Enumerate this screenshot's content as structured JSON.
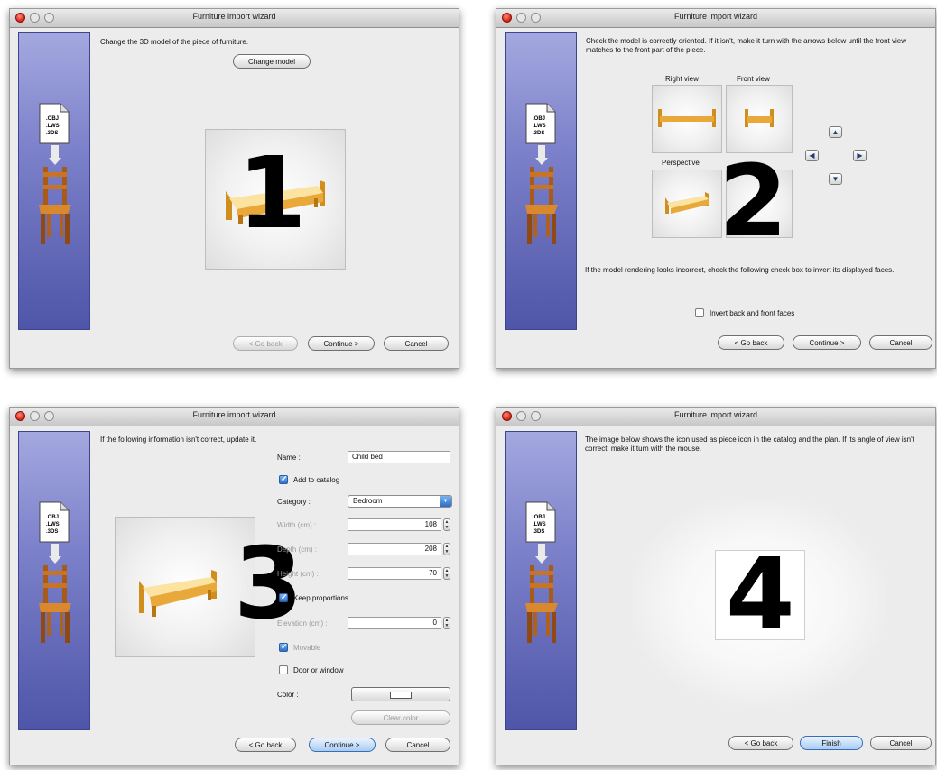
{
  "window_title": "Furniture import wizard",
  "sidebar_file_label": ".OBJ\n.LWS\n.3DS",
  "step1": {
    "instruction": "Change the 3D model of the piece of furniture.",
    "change_model": "Change model",
    "number": "1",
    "back": "< Go back",
    "continue": "Continue >",
    "cancel": "Cancel"
  },
  "step2": {
    "instruction": "Check the model is correctly oriented. If it isn't, make it turn with the arrows below until the front view matches to the front part of the piece.",
    "right_view": "Right view",
    "front_view": "Front view",
    "perspective": "Perspective",
    "arrows": {
      "up": "▲",
      "left": "◀",
      "right": "▶",
      "down": "▼"
    },
    "number": "2",
    "note": "If the model rendering looks incorrect, check the following check box to invert its displayed faces.",
    "invert_faces": "Invert back and front faces",
    "back": "< Go back",
    "continue": "Continue >",
    "cancel": "Cancel"
  },
  "step3": {
    "instruction": "If the following information isn't correct, update it.",
    "name_label": "Name :",
    "name_value": "Child bed",
    "add_to_catalog": "Add to catalog",
    "category_label": "Category :",
    "category_value": "Bedroom",
    "width_label": "Width (cm) :",
    "width_value": "108",
    "depth_label": "Depth (cm) :",
    "depth_value": "208",
    "height_label": "Height (cm) :",
    "height_value": "70",
    "keep_proportions": "Keep proportions",
    "elevation_label": "Elevation (cm) :",
    "elevation_value": "0",
    "movable": "Movable",
    "door_or_window": "Door or window",
    "color_label": "Color :",
    "clear_color": "Clear color",
    "number": "3",
    "back": "< Go back",
    "continue": "Continue >",
    "cancel": "Cancel"
  },
  "step4": {
    "instruction": "The image below shows the icon used as piece icon in the catalog and the plan. If its angle of view isn't correct, make it turn with the mouse.",
    "number": "4",
    "back": "< Go back",
    "finish": "Finish",
    "cancel": "Cancel"
  }
}
